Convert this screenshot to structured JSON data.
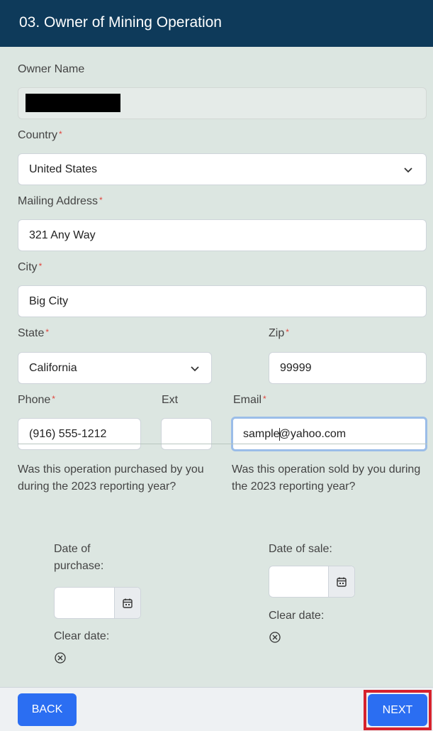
{
  "header": {
    "title": "03. Owner of Mining Operation"
  },
  "owner_name": {
    "label": "Owner Name",
    "value": ""
  },
  "country": {
    "label": "Country",
    "required": "*",
    "value": "United States"
  },
  "mailing_address": {
    "label": "Mailing Address",
    "required": "*",
    "value": "321 Any Way"
  },
  "city": {
    "label": "City",
    "required": "*",
    "value": "Big City"
  },
  "state": {
    "label": "State",
    "required": "*",
    "value": "California"
  },
  "zip": {
    "label": "Zip",
    "required": "*",
    "value": "99999"
  },
  "phone": {
    "label": "Phone",
    "required": "*",
    "value": "(916) 555-1212"
  },
  "ext": {
    "label": "Ext",
    "value": ""
  },
  "email": {
    "label": "Email",
    "required": "*",
    "value_before_caret": "sample",
    "value_after_caret": "@yahoo.com"
  },
  "purchased": {
    "question": "Was this operation purchased by you during the 2023 reporting year?",
    "date_label": "Date of purchase:",
    "date_value": "",
    "clear_label": "Clear date:"
  },
  "sold": {
    "question": "Was this operation sold by you during the 2023 reporting year?",
    "date_label": "Date of sale:",
    "date_value": "",
    "clear_label": "Clear date:"
  },
  "footer": {
    "back_label": "BACK",
    "next_label": "NEXT"
  },
  "icons": {
    "chevron": "chevron-down-icon",
    "calendar": "calendar-icon",
    "clear": "clear-circle-x-icon"
  },
  "colors": {
    "header_bg": "#0e3a5a",
    "page_bg": "#dce6e1",
    "button": "#2b6ef2",
    "required": "#e0443c",
    "highlight": "#d6222d"
  }
}
